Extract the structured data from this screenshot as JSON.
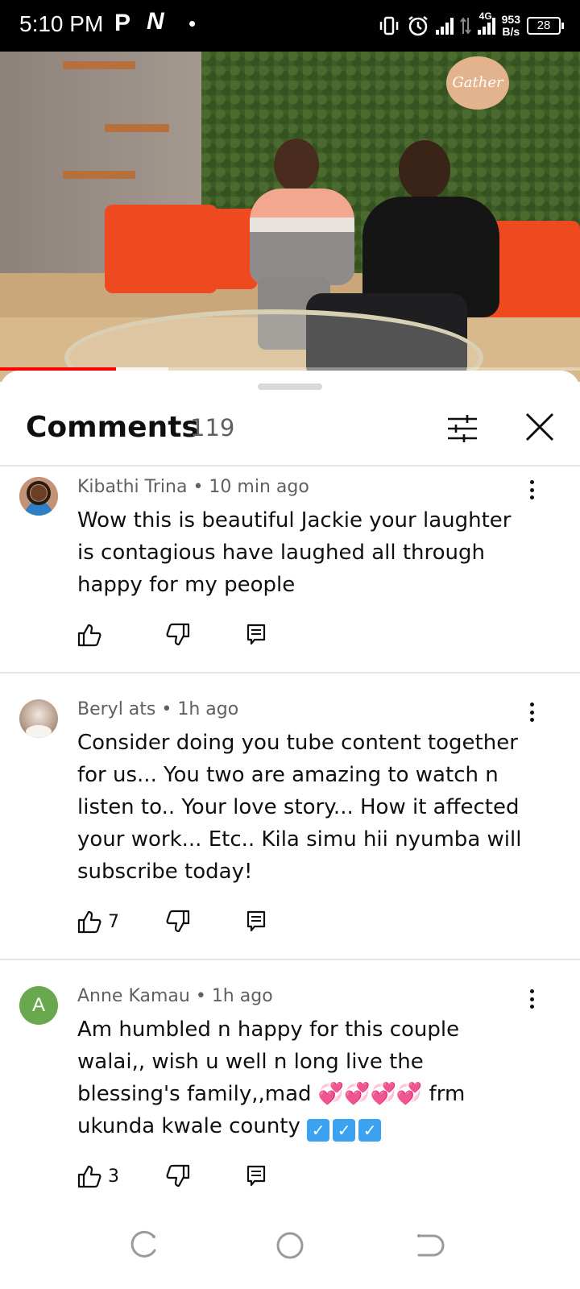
{
  "status_bar": {
    "time": "5:10 PM",
    "app_p": "P",
    "app_n": "N",
    "dot": "•",
    "network": "4G",
    "speed_value": "953",
    "speed_unit": "B/s",
    "battery": "28"
  },
  "video": {
    "sign_text": "Gather",
    "progress_fraction": 0.2,
    "buffer_fraction": 0.29
  },
  "sheet": {
    "title": "Comments",
    "count": "119"
  },
  "comments": [
    {
      "author": "Kibathi Trina",
      "time": "10 min ago",
      "separator": " • ",
      "text": "Wow this is beautiful Jackie your laughter is contagious have laughed all through happy for my people",
      "likes": ""
    },
    {
      "author": "Beryl ats",
      "time": "1h ago",
      "separator": " • ",
      "text": "Consider doing you tube content together for us... You two are amazing to watch n listen to.. Your love story... How it affected your work... Etc.. Kila simu hii nyumba will subscribe today!",
      "likes": "7"
    },
    {
      "author": "Anne Kamau",
      "time": "1h ago",
      "separator": " • ",
      "avatar_letter": "A",
      "text_before": "Am humbled n happy for this couple walai,, wish u well n long live the blessing's family,,mad ",
      "text_hearts": "💞💞💞💞",
      "text_middle": " frm ukunda kwale county ",
      "text_checks": "✓",
      "likes": "3"
    }
  ],
  "colors": {
    "accent": "#ff0000",
    "avatar_green": "#6aa84f",
    "secondary_text": "#606060"
  },
  "icons": [
    "like-icon",
    "dislike-icon",
    "reply-icon",
    "more-vert-icon",
    "filter-icon",
    "close-icon",
    "recents-icon",
    "home-icon",
    "back-icon"
  ]
}
